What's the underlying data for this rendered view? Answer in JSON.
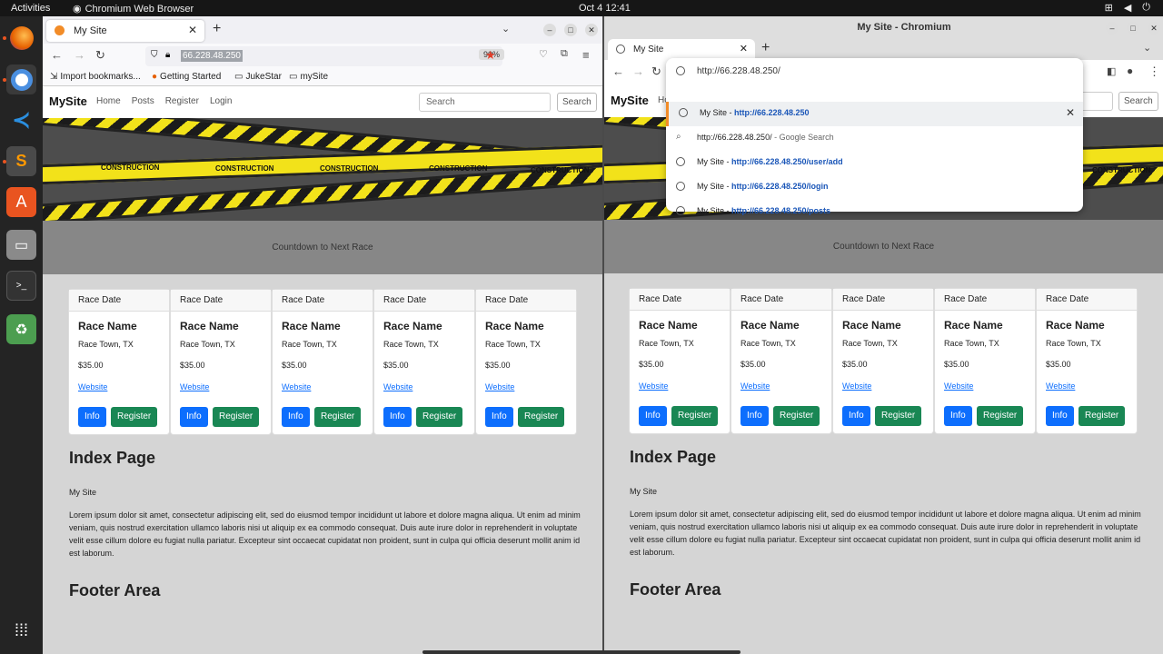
{
  "topbar": {
    "activities": "Activities",
    "app": "Chromium Web Browser",
    "clock": "Oct 4  12:41"
  },
  "firefox": {
    "tab_title": "My Site",
    "url": "66.228.48.250",
    "zoom": "90%",
    "bookmarks": [
      "Import bookmarks...",
      "Getting Started",
      "JukeStar",
      "mySite"
    ]
  },
  "chromium": {
    "window_title": "My Site - Chromium",
    "tab_title": "My Site",
    "omnibox": {
      "input": "http://66.228.48.250/",
      "rows": [
        {
          "prefix": "My Site - ",
          "url": "http://66.228.48.250"
        },
        {
          "prefix": "",
          "url": "http://66.228.48.250/",
          "suffix": " - Google Search"
        },
        {
          "prefix": "My Site - ",
          "url": "http://66.228.48.250/user/add"
        },
        {
          "prefix": "My Site - ",
          "url": "http://66.228.48.250/login"
        },
        {
          "prefix": "My Site - ",
          "url": "http://66.228.48.250/posts"
        }
      ]
    }
  },
  "site": {
    "brand": "MySite",
    "nav": [
      "Home",
      "Posts",
      "Register",
      "Login"
    ],
    "nav_partial": "Ho",
    "search_placeholder": "Search",
    "search_button": "Search",
    "tape_text": "CONSTRUCTION",
    "countdown": "Countdown to Next Race",
    "card": {
      "date": "Race Date",
      "name": "Race Name",
      "town": "Race Town, TX",
      "price": "$35.00",
      "website": "Website",
      "info": "Info",
      "register": "Register"
    },
    "index_heading": "Index Page",
    "subtitle": "My Site",
    "lorem": "Lorem ipsum dolor sit amet, consectetur adipiscing elit, sed do eiusmod tempor incididunt ut labore et dolore magna aliqua. Ut enim ad minim veniam, quis nostrud exercitation ullamco laboris nisi ut aliquip ex ea commodo consequat. Duis aute irure dolor in reprehenderit in voluptate velit esse cillum dolore eu fugiat nulla pariatur. Excepteur sint occaecat cupidatat non proident, sunt in culpa qui officia deserunt mollit anim id est laborum.",
    "footer_heading": "Footer Area"
  },
  "colors": {
    "info": "#0d6efd",
    "register": "#198754",
    "dock": "#242424",
    "ubuntu_orange": "#e95420"
  }
}
